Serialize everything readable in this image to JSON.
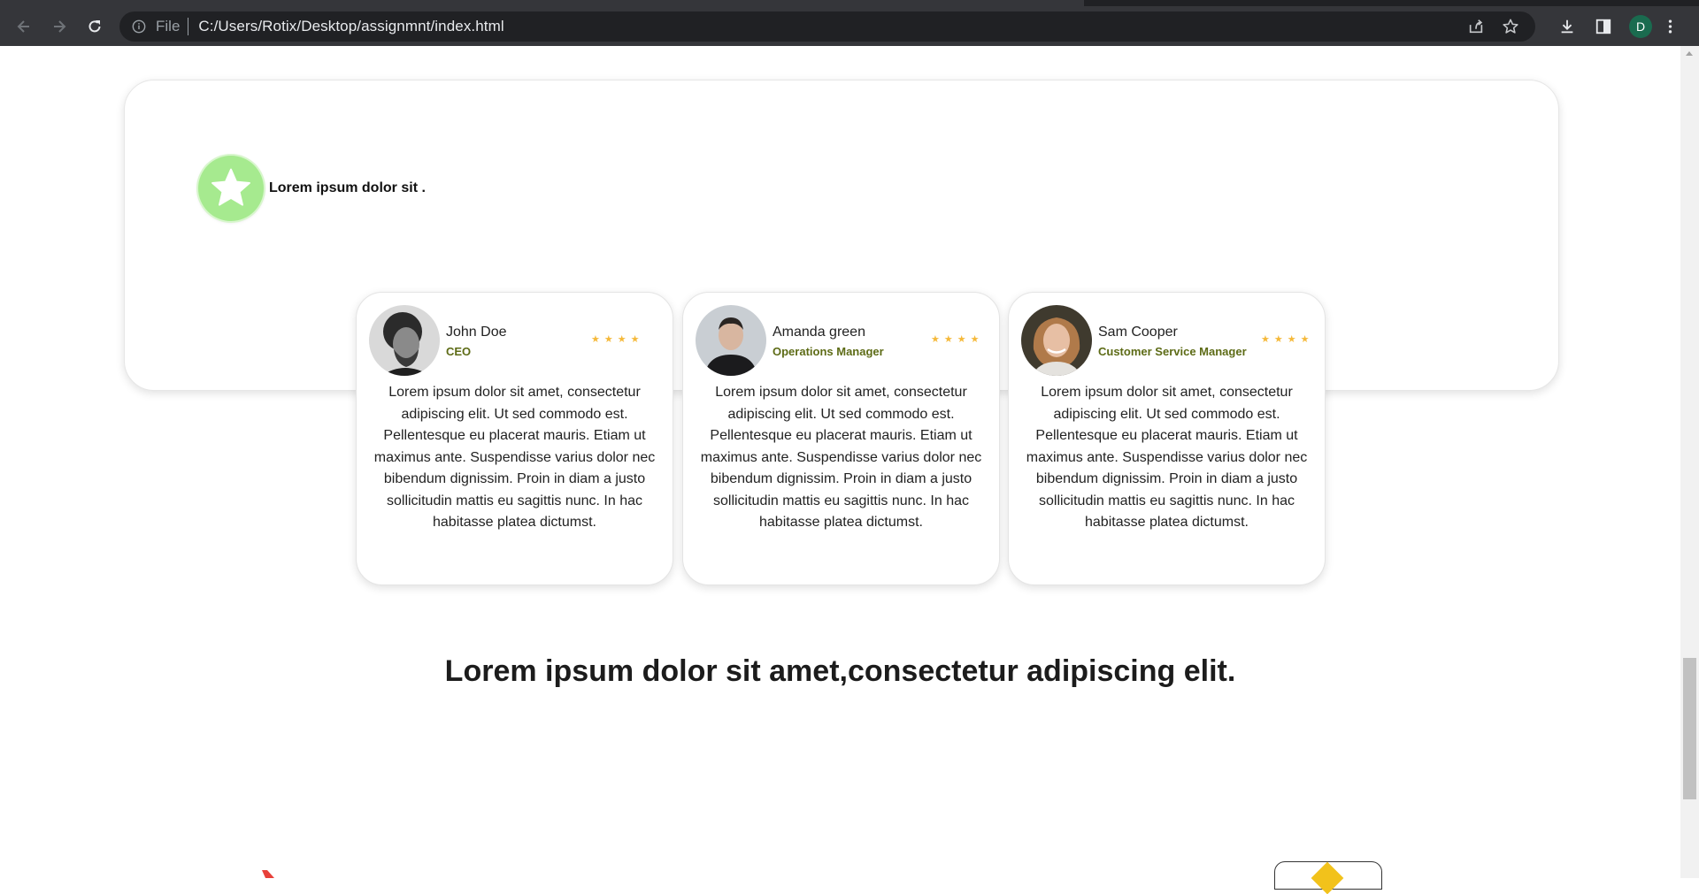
{
  "browser": {
    "scheme_label": "File",
    "url": "C:/Users/Rotix/Desktop/assignmnt/index.html",
    "profile_initial": "D",
    "icons": [
      "back-arrow-icon",
      "forward-arrow-icon",
      "reload-icon",
      "info-icon",
      "share-icon",
      "bookmark-star-icon",
      "download-icon",
      "side-panel-icon",
      "more-vert-icon"
    ]
  },
  "feature": {
    "label": "Lorem ipsum dolor sit .",
    "badge_color": "#a6ea8f"
  },
  "testimonials": [
    {
      "name": "John Doe",
      "role": "CEO",
      "stars": "★★★★",
      "rating": 4,
      "text": "Lorem ipsum dolor sit amet, consectetur adipiscing elit. Ut sed commodo est. Pellentesque eu placerat mauris. Etiam ut maximus ante. Suspendisse varius dolor nec bibendum dignissim. Proin in diam a justo sollicitudin mattis eu sagittis nunc. In hac habitasse platea dictumst."
    },
    {
      "name": "Amanda green",
      "role": "Operations Manager",
      "stars": "★★★★",
      "rating": 4,
      "text": "Lorem ipsum dolor sit amet, consectetur adipiscing elit. Ut sed commodo est. Pellentesque eu placerat mauris. Etiam ut maximus ante. Suspendisse varius dolor nec bibendum dignissim. Proin in diam a justo sollicitudin mattis eu sagittis nunc. In hac habitasse platea dictumst."
    },
    {
      "name": "Sam Cooper",
      "role": "Customer Service Manager",
      "stars": "★★★★",
      "rating": 4,
      "text": "Lorem ipsum dolor sit amet, consectetur adipiscing elit. Ut sed commodo est. Pellentesque eu placerat mauris. Etiam ut maximus ante. Suspendisse varius dolor nec bibendum dignissim. Proin in diam a justo sollicitudin mattis eu sagittis nunc. In hac habitasse platea dictumst."
    }
  ],
  "section_heading": "Lorem ipsum dolor sit amet,consectetur adipiscing elit.",
  "colors": {
    "accent_role": "#5d6b16",
    "star": "#f5b93a",
    "chrome_bg": "#35363a"
  }
}
